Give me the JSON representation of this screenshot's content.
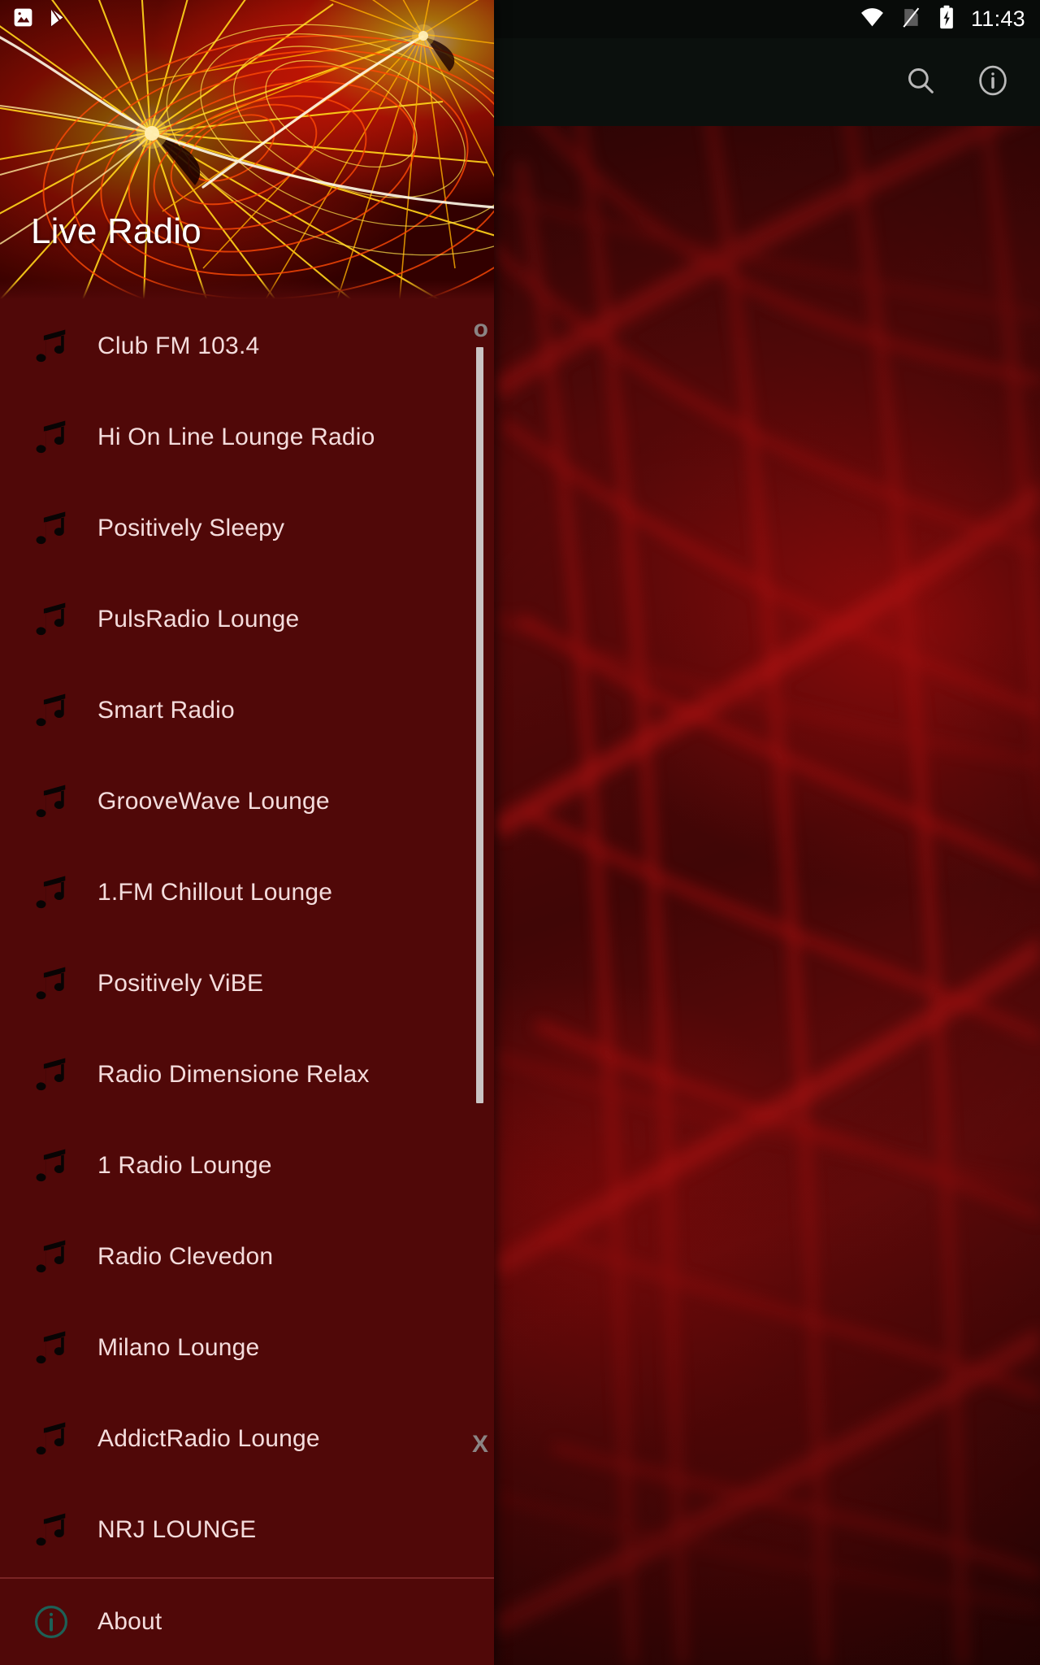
{
  "statusbar": {
    "time": "11:43",
    "left_icons": [
      "image-screenshot-icon",
      "play-store-icon"
    ],
    "right_icons": [
      "wifi-icon",
      "no-sim-icon",
      "battery-charging-icon"
    ]
  },
  "appbar": {
    "search_icon": "search-icon",
    "info_icon": "info-icon",
    "background_color": "#0b100d"
  },
  "drawer": {
    "header_title": "Live Radio",
    "background_color": "#500808",
    "text_color": "#f4dcdc",
    "stations": [
      {
        "label": "Club FM 103.4"
      },
      {
        "label": "Hi On Line Lounge Radio"
      },
      {
        "label": "Positively Sleepy"
      },
      {
        "label": "PulsRadio Lounge"
      },
      {
        "label": "Smart Radio"
      },
      {
        "label": "GrooveWave Lounge"
      },
      {
        "label": "1.FM Chillout Lounge"
      },
      {
        "label": "Positively ViBE"
      },
      {
        "label": "Radio Dimensione Relax"
      },
      {
        "label": "1 Radio Lounge"
      },
      {
        "label": "Radio Clevedon"
      },
      {
        "label": "Milano Lounge"
      },
      {
        "label": "AddictRadio Lounge"
      },
      {
        "label": "NRJ LOUNGE"
      }
    ],
    "scroll_markers": {
      "top_glyph": "o",
      "bottom_glyph": "X"
    },
    "footer": {
      "label": "About",
      "icon": "info-circle-icon",
      "icon_color": "#1d6157"
    }
  }
}
